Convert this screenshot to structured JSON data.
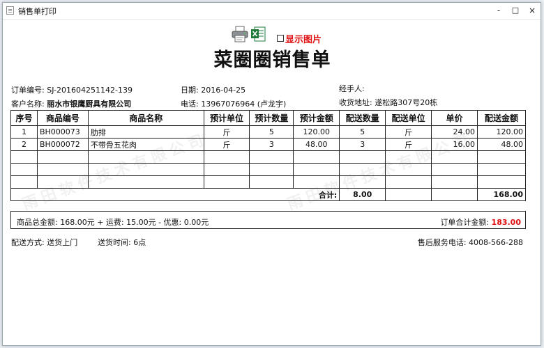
{
  "window": {
    "title": "销售单打印",
    "minimize": "-",
    "maximize": "□",
    "close": "×"
  },
  "toolbar": {
    "print_icon": "printer-icon",
    "excel_icon": "excel-icon",
    "show_images_label": "显示图片",
    "show_images_checked": false
  },
  "document": {
    "title": "菜圈圈销售单",
    "order_no_label": "订单编号:",
    "order_no": "SJ-201604251142-139",
    "date_label": "日期:",
    "date": "2016-04-25",
    "handler_label": "经手人:",
    "handler": "",
    "customer_label": "客户名称:",
    "customer": "丽水市银鹰厨具有限公司",
    "phone_label": "电话:",
    "phone": "13967076964 (卢龙宇)",
    "address_label": "收货地址:",
    "address": "遂松路307号20栋"
  },
  "table": {
    "headers": [
      "序号",
      "商品编号",
      "商品名称",
      "预计单位",
      "预计数量",
      "预计金额",
      "配送数量",
      "配送单位",
      "单价",
      "配送金额"
    ],
    "rows": [
      [
        "1",
        "BH000073",
        "肋排",
        "斤",
        "5",
        "120.00",
        "5",
        "斤",
        "24.00",
        "120.00"
      ],
      [
        "2",
        "BH000072",
        "不带骨五花肉",
        "斤",
        "3",
        "48.00",
        "3",
        "斤",
        "16.00",
        "48.00"
      ]
    ],
    "total_label": "合计:",
    "total_qty": "8.00",
    "total_amount": "168.00"
  },
  "summary": {
    "goods_total": "商品总金额: 168.00元 + 运费: 15.00元 - 优惠: 0.00元",
    "order_total_label": "订单合计金额:",
    "order_total": "183.00"
  },
  "footer": {
    "delivery_method": "配送方式: 送货上门",
    "delivery_time": "送货时间: 6点",
    "service_phone": "售后服务电话: 4008-566-288"
  },
  "watermark": {
    "text_a": "雨田软件技术有限公司",
    "text_b": "雨田软件技术有限公司"
  },
  "colors": {
    "accent_red": "#e01010",
    "border": "#222222"
  }
}
